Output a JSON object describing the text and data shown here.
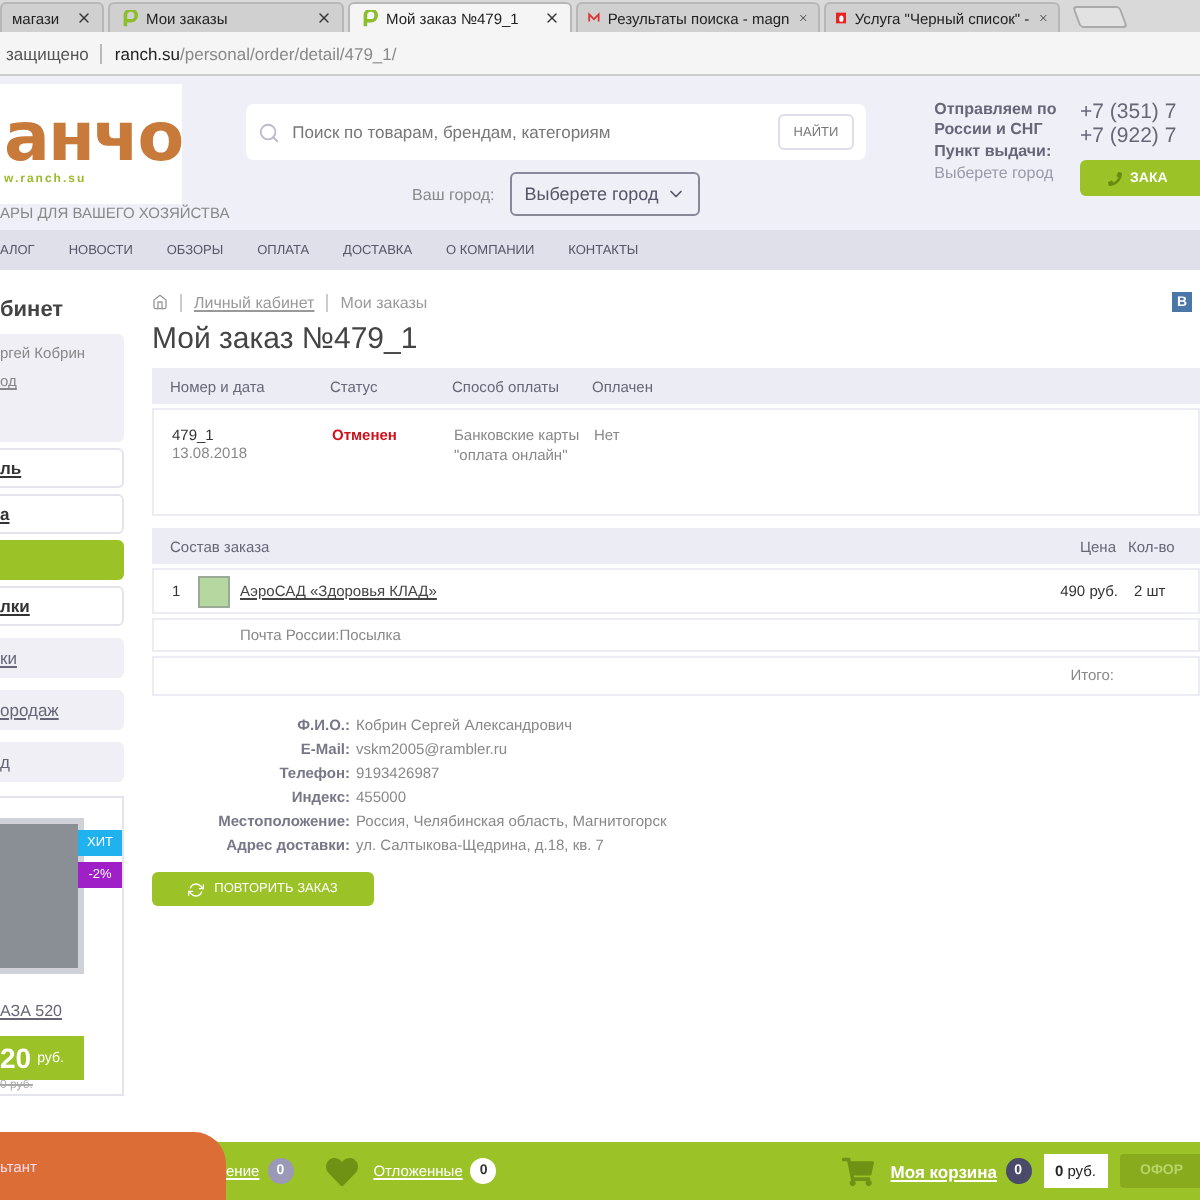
{
  "browser": {
    "tabs": [
      {
        "title": "магази",
        "kind": "plain",
        "selected": false
      },
      {
        "title": "Мои заказы",
        "kind": "site",
        "selected": false
      },
      {
        "title": "Мой заказ №479_1",
        "kind": "site",
        "selected": true
      },
      {
        "title": "Результаты поиска - magn",
        "kind": "mail",
        "selected": false
      },
      {
        "title": "Услуга \"Черный список\" -",
        "kind": "red",
        "selected": false
      }
    ],
    "security": "защищено",
    "url_host": "ranch.su",
    "url_path": "/personal/order/detail/479_1/"
  },
  "header": {
    "logo": "анчо",
    "logo_url": "w.ranch.su",
    "tagline": "АРЫ ДЛЯ ВАШЕГО ХОЗЯЙСТВА",
    "search_placeholder": "Поиск по товарам, брендам, категориям",
    "search_button": "НАЙТИ",
    "city_label": "Ваш город:",
    "city_value": "Выберете город",
    "shipping": "Отправляем по России и СНГ",
    "pickup_label": "Пункт выдачи:",
    "pickup_value": "Выберете город",
    "phones": [
      "+7 (351) 7",
      "+7 (922) 7"
    ],
    "call_button": "ЗАКА"
  },
  "nav": [
    "АЛОГ",
    "НОВОСТИ",
    "ОБЗОРЫ",
    "ОПЛАТА",
    "ДОСТАВКА",
    "О КОМПАНИИ",
    "КОНТАКТЫ"
  ],
  "sidebar": {
    "title": "бинет",
    "user_name": "ргей Кобрин",
    "user_link": "од",
    "items": [
      {
        "label": "ль",
        "kind": "white",
        "selected": false
      },
      {
        "label": "а",
        "kind": "white",
        "selected": false
      },
      {
        "kind": "white",
        "selected": true
      },
      {
        "label": "лки",
        "kind": "white",
        "selected": false
      },
      {
        "label": "ки",
        "kind": "grey",
        "selected": false
      },
      {
        "label": "ородаж",
        "kind": "grey",
        "selected": false
      },
      {
        "label": "д",
        "kind": "grey",
        "selected": false
      }
    ],
    "product": {
      "badges": [
        {
          "text": "ХИТ",
          "color": "#1fb2ee"
        },
        {
          "text": "-2%",
          "color": "#a020c8"
        }
      ],
      "name": "АЗА 520",
      "price": "20",
      "currency": "руб.",
      "old_price": "0 руб."
    }
  },
  "breadcrumbs": [
    "Личный кабинет",
    "Мои заказы"
  ],
  "share_label": "В",
  "title": "Мой заказ №479_1",
  "order": {
    "columns": [
      "Номер и дата",
      "Статус",
      "Способ оплаты",
      "Оплачен"
    ],
    "number": "479_1",
    "date": "13.08.2018",
    "status": "Отменен",
    "payment": "Банковские карты \"оплата онлайн\"",
    "paid": "Нет"
  },
  "items": {
    "columns": [
      "Состав заказа",
      "Цена",
      "Кол-во"
    ],
    "rows": [
      {
        "index": "1",
        "name": "АэроСАД «Здоровья КЛАД»",
        "price": "490 руб.",
        "qty": "2 шт"
      }
    ],
    "delivery": "Почта России:Посылка",
    "total_label": "Итого:"
  },
  "details": [
    {
      "label": "Ф.И.О.:",
      "value": "Кобрин Сергей Александрович"
    },
    {
      "label": "E-Mail:",
      "value": "vskm2005@rambler.ru"
    },
    {
      "label": "Телефон:",
      "value": "9193426987"
    },
    {
      "label": "Индекс:",
      "value": "455000"
    },
    {
      "label": "Местоположение:",
      "value": "Россия, Челябинская область, Магнитогорск"
    },
    {
      "label": "Адрес доставки:",
      "value": "ул. Салтыкова-Щедрина, д.18, кв. 7"
    }
  ],
  "repeat_button": "ПОВТОРИТЬ ЗАКАЗ",
  "bottom_bar": {
    "consultant": "ьтант",
    "compare": "ение",
    "compare_count": "0",
    "wishlist": "Отложенные",
    "wishlist_count": "0",
    "cart": "Моя корзина",
    "cart_count": "0",
    "cart_sum": "0",
    "currency": "руб.",
    "checkout": "ОФОР"
  }
}
